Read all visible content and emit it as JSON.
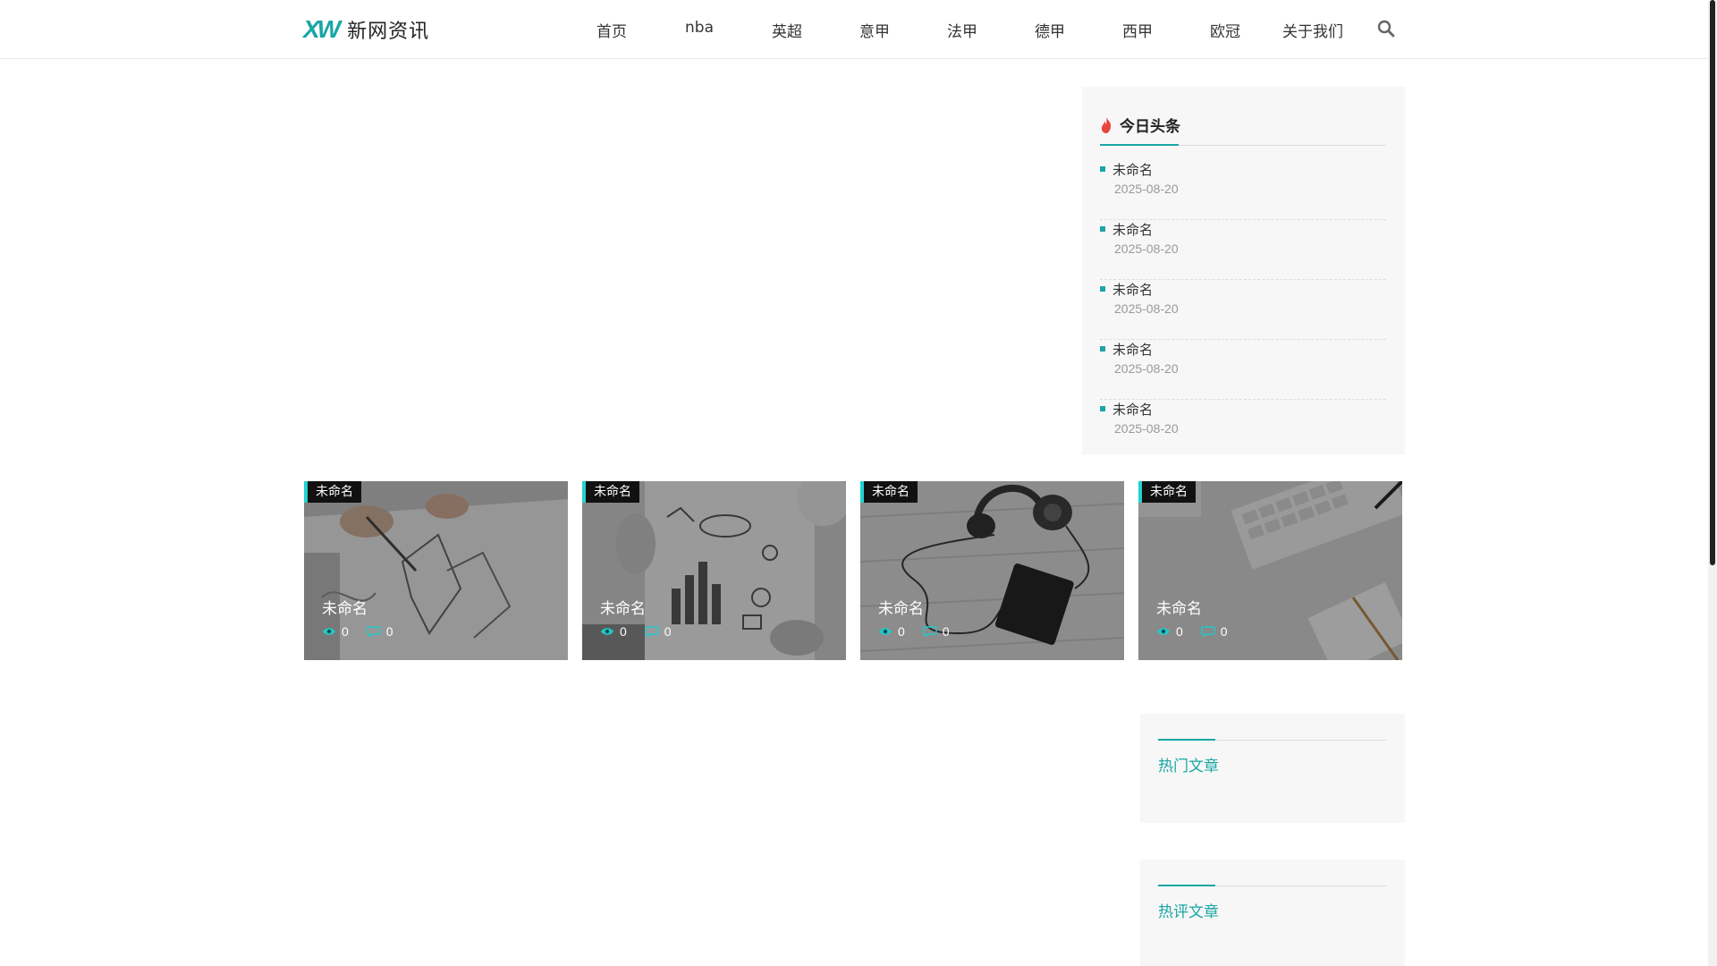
{
  "header": {
    "logo_mark": "XW",
    "logo_text": "新网资讯",
    "nav": [
      "首页",
      "nba",
      "英超",
      "意甲",
      "法甲",
      "德甲",
      "西甲",
      "欧冠",
      "关于我们"
    ]
  },
  "headline_panel": {
    "title": "今日头条",
    "items": [
      {
        "title": "未命名",
        "date": "2025-08-20"
      },
      {
        "title": "未命名",
        "date": "2025-08-20"
      },
      {
        "title": "未命名",
        "date": "2025-08-20"
      },
      {
        "title": "未命名",
        "date": "2025-08-20"
      },
      {
        "title": "未命名",
        "date": "2025-08-20"
      }
    ]
  },
  "cards": [
    {
      "tag": "未命名",
      "title": "未命名",
      "views": "0",
      "comments": "0",
      "image": "sketching-hands"
    },
    {
      "tag": "未命名",
      "title": "未命名",
      "views": "0",
      "comments": "0",
      "image": "doodle-notebook"
    },
    {
      "tag": "未命名",
      "title": "未命名",
      "views": "0",
      "comments": "0",
      "image": "headphones-phone"
    },
    {
      "tag": "未命名",
      "title": "未命名",
      "views": "0",
      "comments": "0",
      "image": "keyboard-desk"
    }
  ],
  "widgets": {
    "hot_articles": "热门文章",
    "hot_comments": "热评文章"
  },
  "colors": {
    "accent": "#1aa6a6",
    "tag_accent": "#22d2d2",
    "panel_bg": "#f7f7f7"
  }
}
